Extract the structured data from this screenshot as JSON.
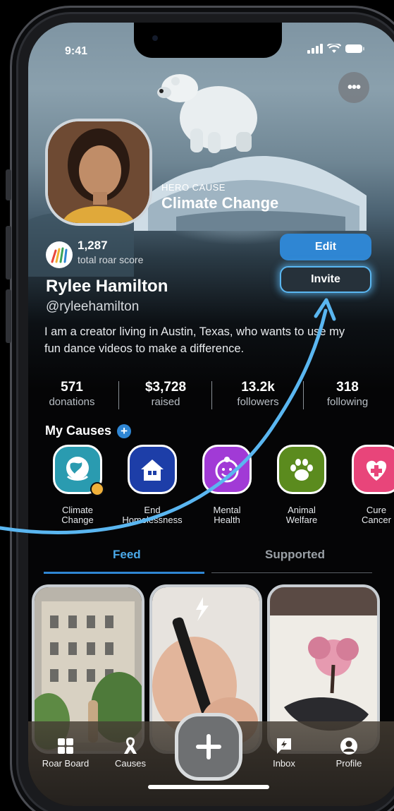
{
  "status": {
    "time": "9:41"
  },
  "hero": {
    "label": "HERO CAUSE",
    "cause": "Climate Change"
  },
  "profile": {
    "score": "1,287",
    "score_label": "total roar score",
    "name": "Rylee Hamilton",
    "handle": "@ryleehamilton",
    "bio": "I am a creator living in Austin, Texas, who wants to use my fun dance videos to make a difference."
  },
  "actions": {
    "edit": "Edit",
    "invite": "Invite"
  },
  "stats": [
    {
      "value": "571",
      "label": "donations"
    },
    {
      "value": "$3,728",
      "label": "raised"
    },
    {
      "value": "13.2k",
      "label": "followers"
    },
    {
      "value": "318",
      "label": "following"
    }
  ],
  "causes": {
    "title": "My Causes",
    "items": [
      {
        "line1": "Climate",
        "line2": "Change",
        "color": "#2a9bb0",
        "icon": "globe-icon"
      },
      {
        "line1": "End",
        "line2": "Homelessness",
        "color": "#1d3ea8",
        "icon": "house-icon"
      },
      {
        "line1": "Mental",
        "line2": "Health",
        "color": "#a13ad6",
        "icon": "smile-icon"
      },
      {
        "line1": "Animal",
        "line2": "Welfare",
        "color": "#5b8b1e",
        "icon": "paw-icon"
      },
      {
        "line1": "Cure",
        "line2": "Cancer",
        "color": "#e8457a",
        "icon": "heart-plus-icon"
      }
    ]
  },
  "tabs": [
    {
      "label": "Feed",
      "active": true
    },
    {
      "label": "Supported",
      "active": false
    }
  ],
  "nav": [
    {
      "label": "Roar Board",
      "icon": "grid-icon"
    },
    {
      "label": "Causes",
      "icon": "ribbon-icon"
    },
    {
      "label": "Inbox",
      "icon": "inbox-bolt-icon"
    },
    {
      "label": "Profile",
      "icon": "person-icon"
    }
  ],
  "colors": {
    "accent": "#2f86d3",
    "glow": "#5ab6f0",
    "background": "#050506"
  }
}
